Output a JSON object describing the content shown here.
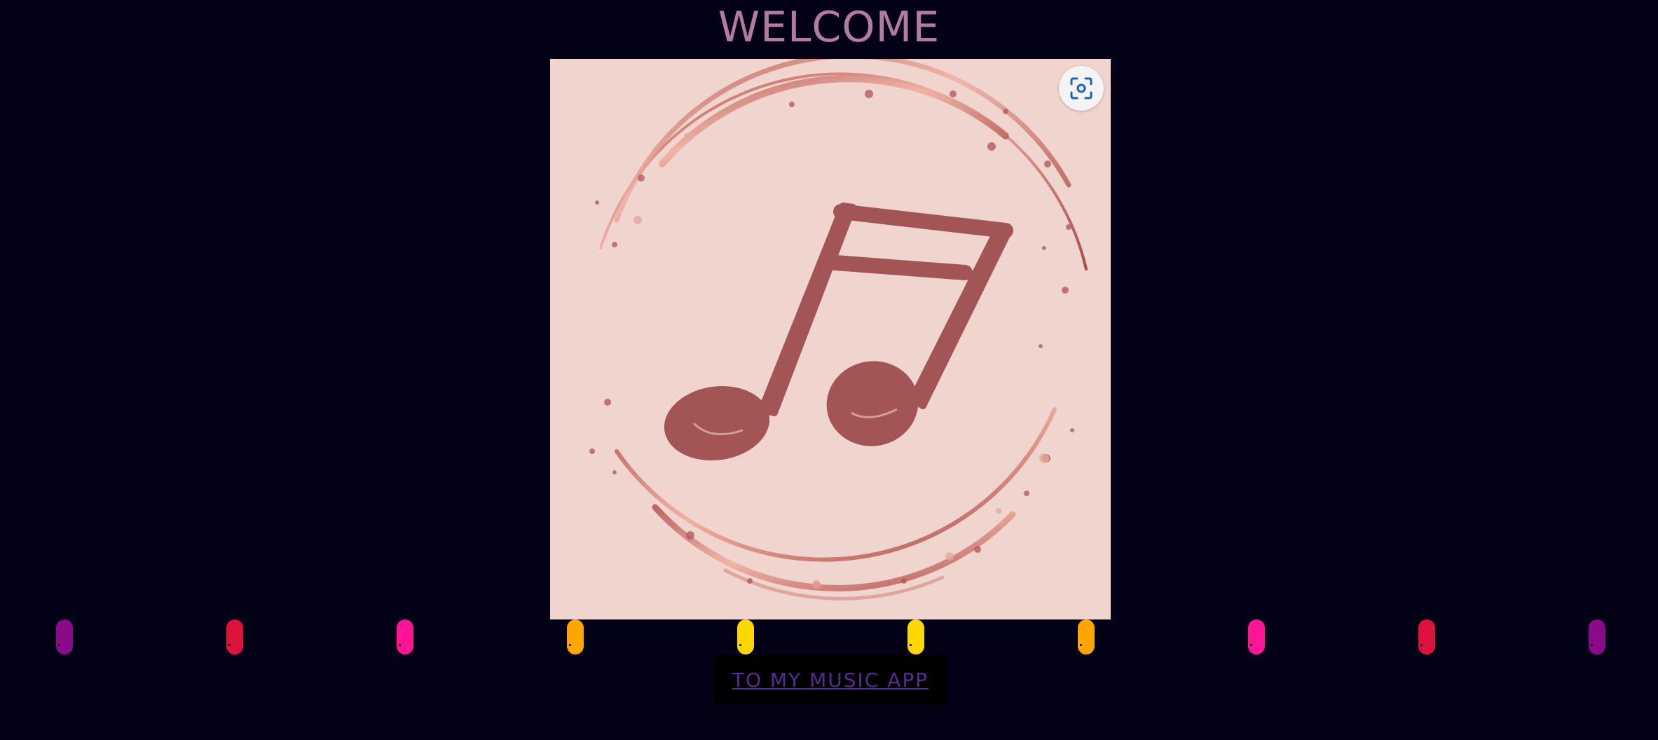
{
  "header": {
    "title": "WELCOME"
  },
  "hero_image": {
    "subject": "music-note-icon",
    "background": "#efd5cd",
    "note_color": "#a35555",
    "ring_color": "#c77a6e"
  },
  "lens_button": {
    "icon": "visual-search-icon",
    "accent": "#1a63b8"
  },
  "equalizer": {
    "colors": [
      "#8a0a8a",
      "#dc143c",
      "#ff1493",
      "#ffa500",
      "#ffd700",
      "#ffd700",
      "#ffa500",
      "#ff1493",
      "#dc143c",
      "#8a0a8a"
    ]
  },
  "cta": {
    "label": "TO MY MUSIC APP",
    "color": "#5a2a8e"
  }
}
